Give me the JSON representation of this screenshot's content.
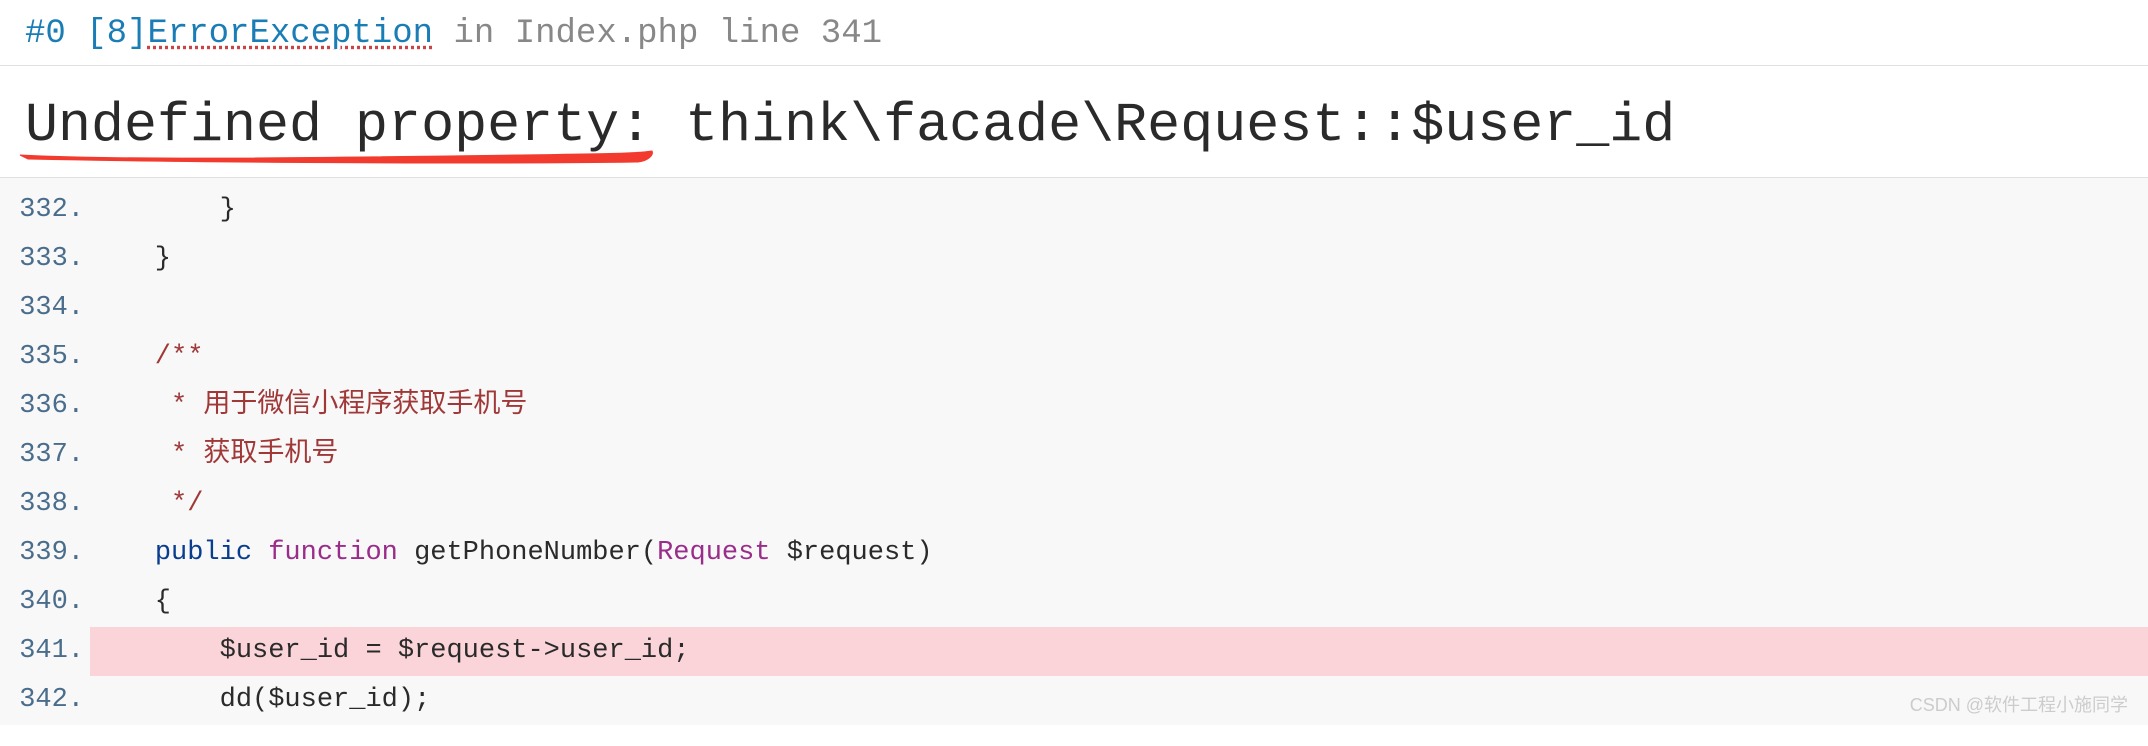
{
  "header": {
    "frame_num": "#0",
    "bracket_num": "[8]",
    "exception": "ErrorException",
    "in_keyword": "in",
    "file": "Index.php",
    "line_keyword": "line",
    "line_num": "341"
  },
  "error_message": "Undefined property: think\\facade\\Request::$user_id",
  "code": {
    "lines": [
      {
        "num": "332.",
        "segments": [
          {
            "cls": "brace",
            "txt": "        }"
          }
        ]
      },
      {
        "num": "333.",
        "segments": [
          {
            "cls": "brace",
            "txt": "    }"
          }
        ]
      },
      {
        "num": "334.",
        "segments": [
          {
            "cls": "",
            "txt": ""
          }
        ]
      },
      {
        "num": "335.",
        "segments": [
          {
            "cls": "comment-doc",
            "txt": "    /**"
          }
        ]
      },
      {
        "num": "336.",
        "segments": [
          {
            "cls": "comment-doc",
            "txt": "     * 用于微信小程序获取手机号"
          }
        ]
      },
      {
        "num": "337.",
        "segments": [
          {
            "cls": "comment-doc",
            "txt": "     * 获取手机号"
          }
        ]
      },
      {
        "num": "338.",
        "segments": [
          {
            "cls": "comment-doc",
            "txt": "     */"
          }
        ]
      },
      {
        "num": "339.",
        "segments": [
          {
            "cls": "",
            "txt": "    "
          },
          {
            "cls": "kw-public",
            "txt": "public"
          },
          {
            "cls": "",
            "txt": " "
          },
          {
            "cls": "kw-function",
            "txt": "function"
          },
          {
            "cls": "",
            "txt": " "
          },
          {
            "cls": "fn-name",
            "txt": "getPhoneNumber"
          },
          {
            "cls": "punct",
            "txt": "("
          },
          {
            "cls": "cls-name",
            "txt": "Request"
          },
          {
            "cls": "",
            "txt": " "
          },
          {
            "cls": "var-name",
            "txt": "$request"
          },
          {
            "cls": "punct",
            "txt": ")"
          }
        ]
      },
      {
        "num": "340.",
        "segments": [
          {
            "cls": "brace",
            "txt": "    {"
          }
        ]
      },
      {
        "num": "341.",
        "highlighted": true,
        "segments": [
          {
            "cls": "",
            "txt": "        "
          },
          {
            "cls": "var-name",
            "txt": "$user_id"
          },
          {
            "cls": "",
            "txt": " = "
          },
          {
            "cls": "var-name",
            "txt": "$request"
          },
          {
            "cls": "punct",
            "txt": "->"
          },
          {
            "cls": "var-name",
            "txt": "user_id"
          },
          {
            "cls": "punct",
            "txt": ";"
          }
        ]
      },
      {
        "num": "342.",
        "segments": [
          {
            "cls": "",
            "txt": "        "
          },
          {
            "cls": "fn-name",
            "txt": "dd"
          },
          {
            "cls": "punct",
            "txt": "("
          },
          {
            "cls": "var-name",
            "txt": "$user_id"
          },
          {
            "cls": "punct",
            "txt": ")"
          },
          {
            "cls": "punct",
            "txt": ";"
          }
        ]
      }
    ]
  },
  "watermark": "CSDN @软件工程小施同学"
}
